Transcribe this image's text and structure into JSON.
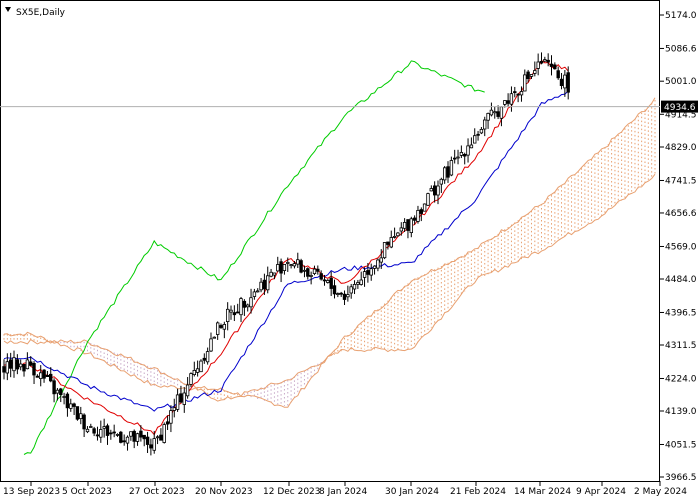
{
  "colors": {
    "background": "#ffffff",
    "frame": "#000000",
    "candle_up_body": "#ffffff",
    "candle_down_body": "#000000",
    "candle_outline": "#000000",
    "tenkan": "#e00000",
    "kijun": "#0000cc",
    "chikou": "#00cc00",
    "kumo_bull": "#e8a070",
    "kumo_bear": "#c8a8c8",
    "current_price_line": "#b0b0b0",
    "price_tag_bg": "#000000",
    "price_tag_text": "#ffffff"
  },
  "chart_data": {
    "type": "candlestick",
    "title": "SX5E,Daily",
    "symbol": "SX5E",
    "timeframe": "Daily",
    "indicator": "Ichimoku Kinko Hyo",
    "ylim": [
      3966.5,
      5174.0
    ],
    "y_ticks": [
      "5174.0",
      "5086.6",
      "5001.0",
      "4914.5",
      "4829.0",
      "4741.5",
      "4656.6",
      "4569.0",
      "4484.0",
      "4396.5",
      "4311.5",
      "4224.0",
      "4139.0",
      "4051.5",
      "3966.5"
    ],
    "x_ticks": [
      "13 Sep 2023",
      "5 Oct 2023",
      "27 Oct 2023",
      "20 Nov 2023",
      "12 Dec 2023",
      "8 Jan 2024",
      "30 Jan 2024",
      "21 Feb 2024",
      "14 Mar 2024",
      "9 Apr 2024",
      "2 May 2024"
    ],
    "current_price": 4934.6,
    "current_price_label": "4934.6",
    "grid": false,
    "series": [
      {
        "name": "Price",
        "type": "candlestick",
        "key_closes": [
          [
            "13 Sep 2023",
            4260
          ],
          [
            "5 Oct 2023",
            4100
          ],
          [
            "27 Oct 2023",
            4050
          ],
          [
            "20 Nov 2023",
            4370
          ],
          [
            "12 Dec 2023",
            4535
          ],
          [
            "8 Jan 2024",
            4440
          ],
          [
            "30 Jan 2024",
            4640
          ],
          [
            "21 Feb 2024",
            4860
          ],
          [
            "14 Mar 2024",
            5050
          ],
          [
            "9 Apr 2024",
            4920
          ],
          [
            "2 May 2024",
            4934.6
          ]
        ]
      },
      {
        "name": "Tenkan-sen",
        "type": "line",
        "key_values": [
          [
            "13 Sep 2023",
            4260
          ],
          [
            "5 Oct 2023",
            4170
          ],
          [
            "27 Oct 2023",
            4080
          ],
          [
            "20 Nov 2023",
            4290
          ],
          [
            "12 Dec 2023",
            4540
          ],
          [
            "8 Jan 2024",
            4470
          ],
          [
            "30 Jan 2024",
            4620
          ],
          [
            "21 Feb 2024",
            4800
          ],
          [
            "14 Mar 2024",
            5050
          ],
          [
            "9 Apr 2024",
            5010
          ],
          [
            "2 May 2024",
            4955
          ]
        ]
      },
      {
        "name": "Kijun-sen",
        "type": "line",
        "key_values": [
          [
            "13 Sep 2023",
            4280
          ],
          [
            "5 Oct 2023",
            4205
          ],
          [
            "27 Oct 2023",
            4140
          ],
          [
            "20 Nov 2023",
            4195
          ],
          [
            "12 Dec 2023",
            4470
          ],
          [
            "8 Jan 2024",
            4510
          ],
          [
            "30 Jan 2024",
            4525
          ],
          [
            "21 Feb 2024",
            4690
          ],
          [
            "14 Mar 2024",
            4940
          ],
          [
            "9 Apr 2024",
            5020
          ],
          [
            "2 May 2024",
            4955
          ]
        ]
      },
      {
        "name": "Chikou Span",
        "type": "line",
        "key_values": [
          [
            "13 Sep 2023",
            4030
          ],
          [
            "5 Oct 2023",
            4320
          ],
          [
            "27 Oct 2023",
            4580
          ],
          [
            "20 Nov 2023",
            4480
          ],
          [
            "12 Dec 2023",
            4730
          ],
          [
            "8 Jan 2024",
            4910
          ],
          [
            "30 Jan 2024",
            5050
          ],
          [
            "21 Feb 2024",
            4980
          ],
          [
            "14 Mar 2024",
            4940
          ]
        ]
      },
      {
        "name": "Senkou Span A",
        "type": "line",
        "key_values": [
          [
            "13 Sep 2023",
            4340
          ],
          [
            "5 Oct 2023",
            4290
          ],
          [
            "27 Oct 2023",
            4205
          ],
          [
            "20 Nov 2023",
            4195
          ],
          [
            "12 Dec 2023",
            4150
          ],
          [
            "8 Jan 2024",
            4330
          ],
          [
            "30 Jan 2024",
            4480
          ],
          [
            "21 Feb 2024",
            4560
          ],
          [
            "14 Mar 2024",
            4680
          ],
          [
            "9 Apr 2024",
            4820
          ],
          [
            "2 May 2024",
            4960
          ]
        ]
      },
      {
        "name": "Senkou Span B",
        "type": "line",
        "key_values": [
          [
            "13 Sep 2023",
            4320
          ],
          [
            "5 Oct 2023",
            4320
          ],
          [
            "27 Oct 2023",
            4250
          ],
          [
            "20 Nov 2023",
            4165
          ],
          [
            "12 Dec 2023",
            4220
          ],
          [
            "8 Jan 2024",
            4300
          ],
          [
            "30 Jan 2024",
            4300
          ],
          [
            "21 Feb 2024",
            4480
          ],
          [
            "14 Mar 2024",
            4560
          ],
          [
            "9 Apr 2024",
            4650
          ],
          [
            "2 May 2024",
            4760
          ]
        ]
      }
    ]
  }
}
